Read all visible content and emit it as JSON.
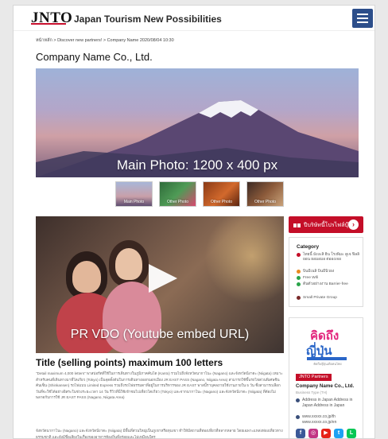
{
  "header": {
    "logo": "JNTO",
    "tagline": "Japan Tourism New Possibilities"
  },
  "breadcrumb": "หน้าหลัก > Discover new partners! > Company Name 2020/08/04 10:30",
  "page_title": "Company Name Co., Ltd.",
  "main_photo": {
    "label": "Main Photo: 1200 x 400 px"
  },
  "thumbnails": [
    {
      "label": "Main Photo"
    },
    {
      "label": "Other Photo"
    },
    {
      "label": "Other Photo"
    },
    {
      "label": "Other Photo"
    }
  ],
  "video": {
    "label": "PR VDO (Youtube embed URL)"
  },
  "content": {
    "title": "Title (selling points) maximum 100 letters",
    "paragraph1": "\"Detail maximum 4,000 letters\" พาสปอร์ตที่ใช้ในการเดินทางในภูมิภาคคันโต (Kanto) รวมไปถึงจังหวัดนากาโนะ (Nagano) และจังหวัดนีงาตะ (Niigata) เหมาะสำหรับคนที่เดินทางมาที่โตเกียว (Tokyo) เป็นจุดตั้งต้นในการเดินทางออกนอกเมือง JR EAST PASS (Nagano, Niigata Area) สามารถใช้ขึ้นรถไฟด่วนพิเศษชินคันเซ็น (Shinkansen) รถไฟแบบ Limited Express รวมถึงรถไฟธรรมดาที่อยู่ในการบริหารของ JR EAST พาสนี้ราบุคลภายใช้งานภายใน 5 วัน ซึ่งสามารถเลือกวันที่จะใช้ได้อย่างอิสระในช่วงระยะเวลา 14 วัน รีวิวที่นี่ใช้เข้าชมไปเที่ยวโตเกียว (Tokyo) และจากนากาโนะ (Nagano) และจังหวัดนีงาตะ (Niigata) ที่ต้องไม่พลาดกับการใช้ JR EAST PASS (Nagano, Niigata Area)",
    "paragraph2": "จังหวัดนากาโนะ (Nagano) และจังหวัดนีงาตะ (Niigata) มีพื้นที่ส่วนใหญ่เป็นภูเขาหรือหุบเขา ทำให้มีสถานที่ท่องเที่ยวที่หลากหลาย โดยเฉพาะแหล่งท่องเที่ยวทางธรรมชาติ และยังมีชื่อเสียงในเรื่องของอาหารท้องถิ่นที่อร่อยและไม่เหมือนใคร"
  },
  "sidebar": {
    "button_label": "ปีบริษัทนี้โปรไฟล์บุ๊ค",
    "category": {
      "title": "Category",
      "items": [
        {
          "text": "ไทยนี้ มังงะสิ ฮิน โรงพิมะ ดูเจ ฟิลลิยอน ยอมอมอ ต่อองเจอ",
          "color": "#c40e28"
        },
        {
          "text": "บินมีเนลิ บินมีนิวยง",
          "color": "#e98a1f"
        },
        {
          "text": "Free Wifi",
          "color": "#2aa44a"
        },
        {
          "text": "ต้นตัวอย่างงาน Barrier-free",
          "color": "#2aa44a"
        },
        {
          "text": "Small Private Group",
          "color": "#7a2a2a"
        }
      ]
    },
    "partner": {
      "logo_line1": "คิดถึง",
      "logo_line2": "ญี่ปุ่น",
      "logo_sub": "คิดถึงญี่ปุ่นเพื่อคนไทย",
      "badge": "JNTO Partners",
      "name": "Company Name Co., Ltd.",
      "type": "Business Type (TH)",
      "address": "Address in Japan Address in Japan Address in Japan",
      "website": "www.xxxxx.co.jp/th www.xxxxx.co.jp/en",
      "socials": [
        {
          "icon": "facebook-icon",
          "glyph": "f",
          "color": "#3b5998"
        },
        {
          "icon": "instagram-icon",
          "glyph": "◎",
          "color": "#c13584"
        },
        {
          "icon": "youtube-icon",
          "glyph": "▶",
          "color": "#e62117"
        },
        {
          "icon": "twitter-icon",
          "glyph": "t",
          "color": "#1da1f2"
        },
        {
          "icon": "line-icon",
          "glyph": "L",
          "color": "#06c755"
        }
      ]
    }
  },
  "colors": {
    "brand_red": "#c40e28",
    "menu_blue": "#2c4e8a"
  }
}
